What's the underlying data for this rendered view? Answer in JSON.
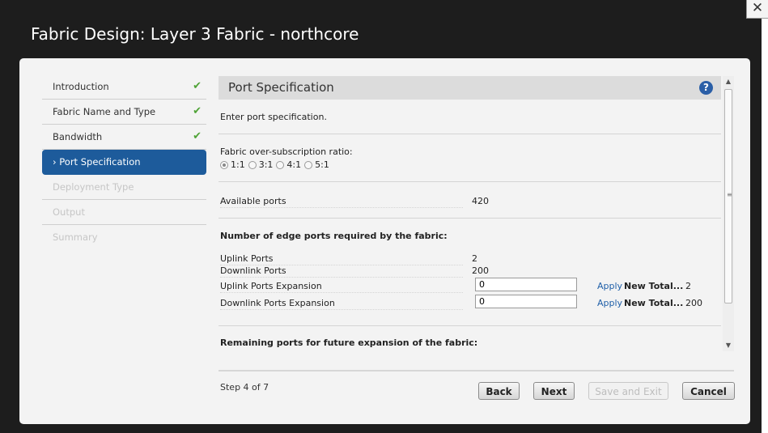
{
  "window": {
    "close_glyph": "✕",
    "title": "Fabric Design: Layer 3 Fabric - northcore"
  },
  "sidebar": {
    "items": [
      {
        "label": "Introduction",
        "state": "done"
      },
      {
        "label": "Fabric Name and Type",
        "state": "done"
      },
      {
        "label": "Bandwidth",
        "state": "done"
      },
      {
        "label": "Port Specification",
        "state": "active"
      },
      {
        "label": "Deployment Type",
        "state": "disabled"
      },
      {
        "label": "Output",
        "state": "disabled"
      },
      {
        "label": "Summary",
        "state": "disabled"
      }
    ],
    "check_glyph": "✔",
    "active_prefix": "›"
  },
  "panel": {
    "title": "Port Specification",
    "help_glyph": "?",
    "intro": "Enter port specification.",
    "ratio": {
      "label": "Fabric over-subscription ratio:",
      "options": [
        "1:1",
        "3:1",
        "4:1",
        "5:1"
      ],
      "selected": "1:1"
    },
    "available": {
      "label": "Available ports",
      "value": "420"
    },
    "edge": {
      "heading": "Number of edge ports required by the fabric:",
      "uplink": {
        "label": "Uplink Ports",
        "value": "2"
      },
      "downlink": {
        "label": "Downlink Ports",
        "value": "200"
      },
      "uplink_exp": {
        "label": "Uplink Ports Expansion",
        "value": "0",
        "apply": "Apply",
        "new_total_label": "New Total...",
        "new_total": "2"
      },
      "downlink_exp": {
        "label": "Downlink Ports Expansion",
        "value": "0",
        "apply": "Apply",
        "new_total_label": "New Total...",
        "new_total": "200"
      }
    },
    "remaining": {
      "heading": "Remaining ports for future expansion of the fabric:"
    }
  },
  "footer": {
    "step": "Step 4 of 7",
    "back": "Back",
    "next": "Next",
    "save_exit": "Save and Exit",
    "cancel": "Cancel"
  },
  "colors": {
    "active": "#1d5b9b",
    "check": "#4fa336",
    "link": "#1f5fa8"
  }
}
